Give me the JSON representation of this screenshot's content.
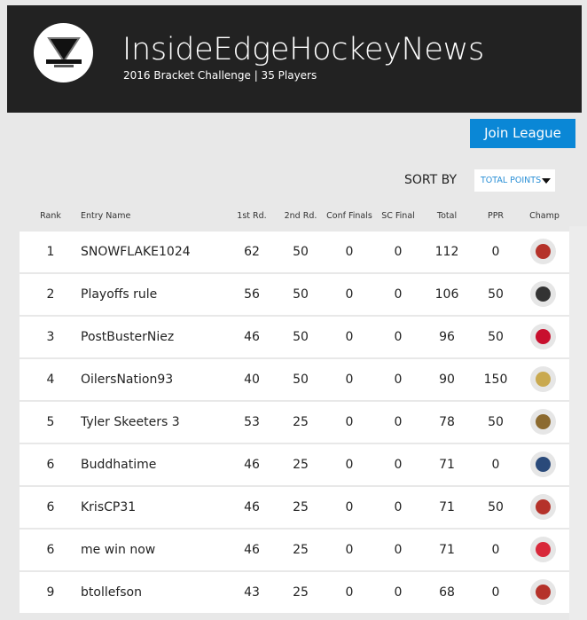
{
  "header": {
    "title": "InsideEdgeHockeyNews",
    "subtitle": "2016 Bracket Challenge | 35 Players",
    "logo_text": "inside edge Hockey News"
  },
  "join_label": "Join League",
  "sort": {
    "label": "SORT BY",
    "selected": "TOTAL POINTS"
  },
  "columns": [
    "Rank",
    "Entry Name",
    "1st Rd.",
    "2nd Rd.",
    "Conf Finals",
    "SC Final",
    "Total",
    "PPR",
    "Champ"
  ],
  "rows": [
    {
      "rank": "1",
      "name": "SNOWFLAKE1024",
      "r1": "62",
      "r2": "50",
      "cf": "0",
      "sc": "0",
      "total": "112",
      "ppr": "0",
      "champ": "chicago-blackhawks",
      "color": "#b5322a"
    },
    {
      "rank": "2",
      "name": "Playoffs rule",
      "r1": "56",
      "r2": "50",
      "cf": "0",
      "sc": "0",
      "total": "106",
      "ppr": "50",
      "champ": "los-angeles-kings",
      "color": "#333333"
    },
    {
      "rank": "3",
      "name": "PostBusterNiez",
      "r1": "46",
      "r2": "50",
      "cf": "0",
      "sc": "0",
      "total": "96",
      "ppr": "50",
      "champ": "washington-capitals",
      "color": "#c8102e"
    },
    {
      "rank": "4",
      "name": "OilersNation93",
      "r1": "40",
      "r2": "50",
      "cf": "0",
      "sc": "0",
      "total": "90",
      "ppr": "150",
      "champ": "pittsburgh-penguins",
      "color": "#c9a94f"
    },
    {
      "rank": "5",
      "name": "Tyler Skeeters 3",
      "r1": "53",
      "r2": "25",
      "cf": "0",
      "sc": "0",
      "total": "78",
      "ppr": "50",
      "champ": "anaheim-ducks",
      "color": "#8c6a2f"
    },
    {
      "rank": "6",
      "name": "Buddhatime",
      "r1": "46",
      "r2": "25",
      "cf": "0",
      "sc": "0",
      "total": "71",
      "ppr": "0",
      "champ": "florida-panthers",
      "color": "#2a4a7a"
    },
    {
      "rank": "6",
      "name": "KrisCP31",
      "r1": "46",
      "r2": "25",
      "cf": "0",
      "sc": "0",
      "total": "71",
      "ppr": "50",
      "champ": "chicago-blackhawks",
      "color": "#b5322a"
    },
    {
      "rank": "6",
      "name": "me win now",
      "r1": "46",
      "r2": "25",
      "cf": "0",
      "sc": "0",
      "total": "71",
      "ppr": "0",
      "champ": "detroit-red-wings",
      "color": "#d8283a"
    },
    {
      "rank": "9",
      "name": "btollefson",
      "r1": "43",
      "r2": "25",
      "cf": "0",
      "sc": "0",
      "total": "68",
      "ppr": "0",
      "champ": "chicago-blackhawks",
      "color": "#b5322a"
    }
  ]
}
